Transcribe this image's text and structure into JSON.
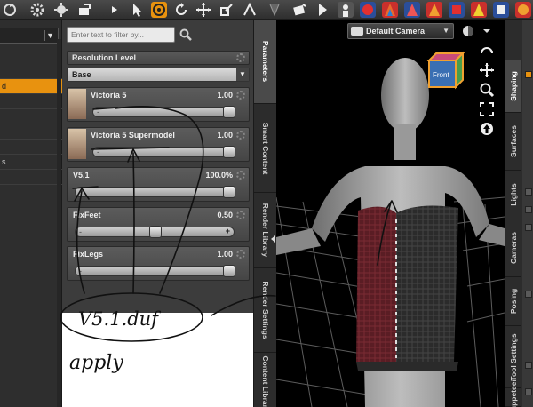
{
  "toolbar": {
    "icons": [
      "rotate-icon",
      "settings-gear-icon",
      "lighting-icon",
      "geometry-tool-icon",
      "pointer-icon",
      "universal-tool-icon",
      "rotate-tool-icon",
      "translate-tool-icon",
      "scale-tool-icon",
      "node-tool-icon",
      "surface-tool-icon",
      "render-icon",
      "iray-icon",
      "pose-icon",
      "morph-icon",
      "shape-icon",
      "texture-icon"
    ],
    "accent": "#e8920f"
  },
  "left_dock": {
    "rows": [
      {
        "label": "",
        "selected": false
      },
      {
        "label": "d",
        "selected": true
      },
      {
        "label": "",
        "selected": false
      },
      {
        "label": "",
        "selected": false
      },
      {
        "label": "",
        "selected": false
      },
      {
        "label": "",
        "selected": false
      },
      {
        "label": "s",
        "selected": false
      },
      {
        "label": "",
        "selected": false
      }
    ]
  },
  "parameters": {
    "filter_placeholder": "Enter text to filter by...",
    "resolution_level": {
      "header": "Resolution Level",
      "value": "Base"
    },
    "sliders": [
      {
        "name": "Victoria 5",
        "value": "1.00",
        "level": 1.0,
        "has_thumb": true
      },
      {
        "name": "Victoria 5 Supermodel",
        "value": "1.00",
        "level": 1.0,
        "has_thumb": true
      },
      {
        "name": "V5.1",
        "value": "100.0%",
        "level": 1.0,
        "has_thumb": false
      },
      {
        "name": "FixFeet",
        "value": "0.50",
        "level": 0.5,
        "has_thumb": false
      },
      {
        "name": "FixLegs",
        "value": "1.00",
        "level": 1.0,
        "has_thumb": false
      }
    ]
  },
  "side_tabs": [
    "Parameters",
    "Smart Content",
    "Render Library",
    "Render Settings",
    "Content Library"
  ],
  "viewport": {
    "camera": "Default Camera",
    "view_cube_label": "Front"
  },
  "right_tabs": [
    "Shaping",
    "Surfaces",
    "Lights",
    "Cameras",
    "Posing",
    "Tool Settings",
    "Puppeteer"
  ],
  "annotation": {
    "circled_text": "V5.1.duf",
    "note": "apply"
  }
}
